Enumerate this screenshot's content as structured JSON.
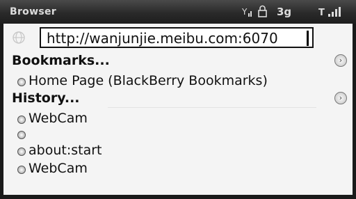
{
  "app": {
    "title": "Browser"
  },
  "status_bar": {
    "network": "3g",
    "icons": [
      "signal-indicator-icon",
      "lock-icon",
      "signal-bars-icon"
    ],
    "bars_label": "T.ıll"
  },
  "url_bar": {
    "value": "http://wanjunjie.meibu.com:6070",
    "icon": "globe-icon"
  },
  "bookmarks": {
    "heading": "Bookmarks...",
    "items": [
      {
        "label": "Home Page (BlackBerry Bookmarks)"
      }
    ]
  },
  "history": {
    "heading": "History...",
    "items": [
      {
        "label": "WebCam"
      },
      {
        "label": ""
      },
      {
        "label": "about:start"
      },
      {
        "label": "WebCam"
      }
    ]
  },
  "colors": {
    "title_bar": "#2a2a2a",
    "screen_bg": "#f4f4f4",
    "text": "#111111"
  }
}
